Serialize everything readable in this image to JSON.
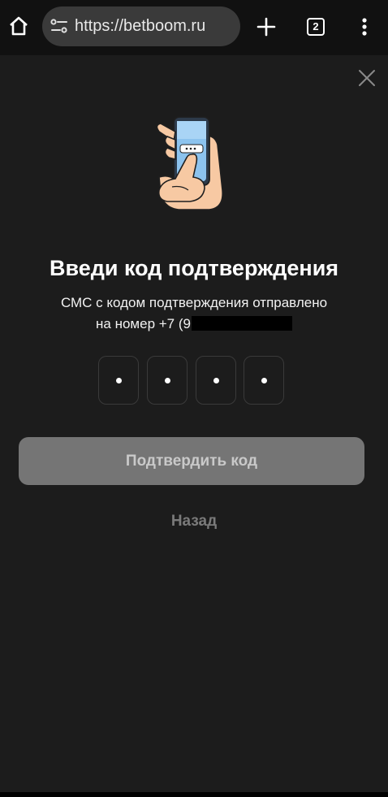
{
  "browser": {
    "url": "https://betboom.ru",
    "tab_count": "2",
    "icons": [
      "home-icon",
      "site-settings-icon",
      "plus-icon",
      "tabs-icon",
      "more-vert-icon"
    ]
  },
  "modal": {
    "close_icon": "close-icon",
    "illustration": "phone-in-hand-illustration",
    "title": "Введи код подтверждения",
    "subtitle_line1": "СМС с кодом подтверждения отправлено",
    "subtitle_line2_prefix": "на номер +7 (9",
    "code_cells": [
      "•",
      "•",
      "•",
      "•"
    ],
    "confirm_label": "Подтвердить код",
    "back_label": "Назад"
  },
  "colors": {
    "background": "#1c1c1c",
    "toolbar": "#111111",
    "confirm_disabled": "#757575",
    "back_link": "#7a7a7a"
  }
}
